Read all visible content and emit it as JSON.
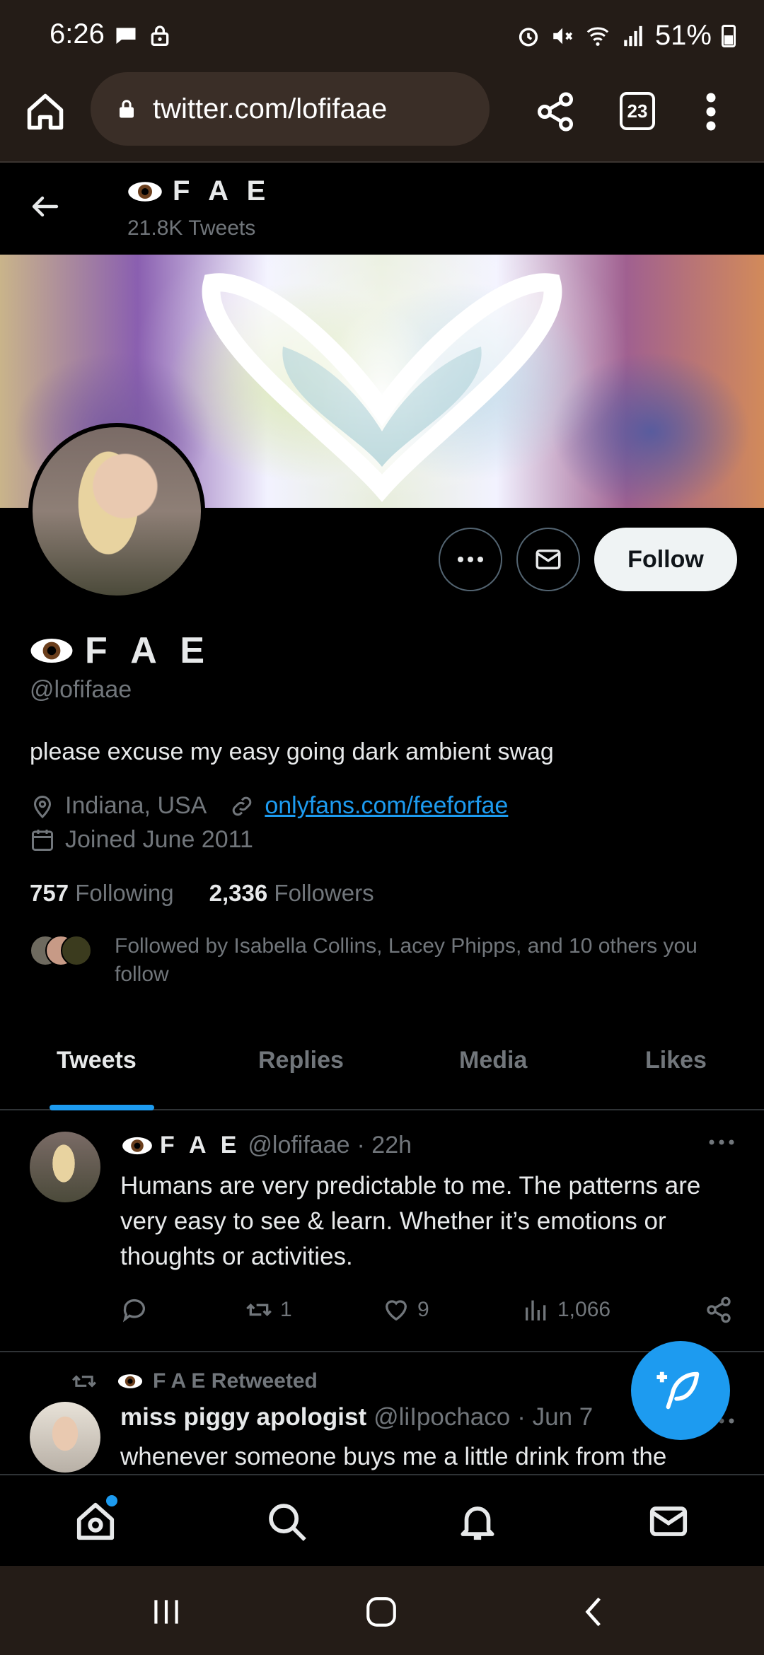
{
  "status_bar": {
    "time": "6:26",
    "battery": "51%",
    "left_icons": [
      "chat-bubble-icon",
      "lock-icon"
    ],
    "right_icons": [
      "alarm-icon",
      "mute-icon",
      "wifi-icon",
      "signal-icon",
      "battery-icon"
    ]
  },
  "browser": {
    "url": "twitter.com/lofifaae",
    "tab_count": "23"
  },
  "header": {
    "name": "F A E",
    "tweet_count": "21.8K Tweets"
  },
  "profile": {
    "name": "F A E",
    "handle": "@lofifaae",
    "bio": "please excuse my easy going dark ambient swag",
    "location": "Indiana, USA",
    "link": "onlyfans.com/feeforfae",
    "joined": "Joined June 2011",
    "following_count": "757",
    "following_label": "Following",
    "followers_count": "2,336",
    "followers_label": "Followers",
    "followed_by": "Followed by Isabella Collins, Lacey Phipps, and 10 others you follow",
    "follow_label": "Follow"
  },
  "tabs": [
    "Tweets",
    "Replies",
    "Media",
    "Likes"
  ],
  "tweet": {
    "name": "F A E",
    "handle": "@lofifaae",
    "time": "· 22h",
    "text": "Humans are very predictable to me. The patterns are very easy to see & learn. Whether it’s emotions or thoughts or activities.",
    "retweets": "1",
    "likes": "9",
    "views": "1,066"
  },
  "retweet": {
    "label": "F A E Retweeted",
    "name": "miss piggy apologist",
    "handle": "@liIpochaco",
    "time": "· Jun 7",
    "text": "whenever someone buys me a little drink from the"
  },
  "colors": {
    "accent": "#1d9bf0",
    "browser_bg": "#241c17",
    "muted_text": "#71767b"
  }
}
